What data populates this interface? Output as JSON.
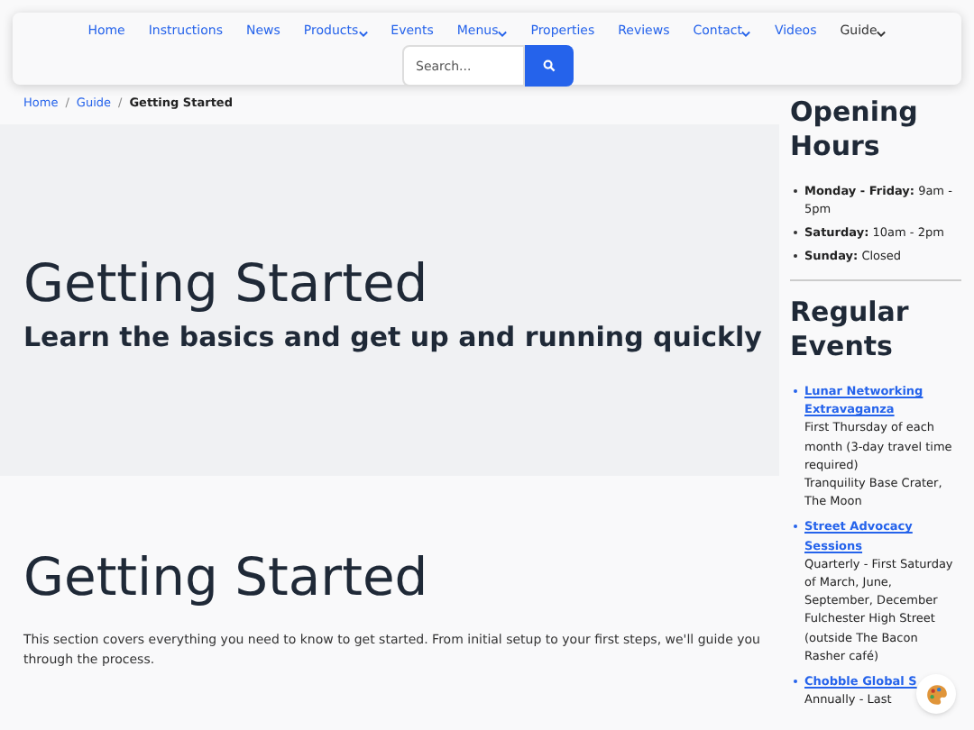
{
  "nav": {
    "items": [
      {
        "label": "Home",
        "dropdown": false,
        "selected": false
      },
      {
        "label": "Instructions",
        "dropdown": false,
        "selected": false
      },
      {
        "label": "News",
        "dropdown": false,
        "selected": false
      },
      {
        "label": "Products",
        "dropdown": true,
        "selected": false
      },
      {
        "label": "Events",
        "dropdown": false,
        "selected": false
      },
      {
        "label": "Menus",
        "dropdown": true,
        "selected": false
      },
      {
        "label": "Properties",
        "dropdown": false,
        "selected": false
      },
      {
        "label": "Reviews",
        "dropdown": false,
        "selected": false
      },
      {
        "label": "Contact",
        "dropdown": true,
        "selected": false
      },
      {
        "label": "Videos",
        "dropdown": false,
        "selected": false
      },
      {
        "label": "Guide",
        "dropdown": true,
        "selected": true
      }
    ],
    "search": {
      "placeholder": "Search..."
    }
  },
  "breadcrumb": [
    {
      "label": "Home",
      "separator": "/"
    },
    {
      "label": "Guide",
      "separator": "/"
    },
    {
      "label": "Getting Started"
    }
  ],
  "hero": {
    "title": "Getting Started",
    "subtitle": "Learn the basics and get up and running quickly"
  },
  "section": {
    "title": "Getting Started",
    "text": "This section covers everything you need to know to get started. From initial setup to your first steps, we'll guide you through the process."
  },
  "sidebar": {
    "hours_title": "Opening Hours",
    "hours": [
      {
        "day": "Monday - Friday:",
        "time": "9am - 5pm"
      },
      {
        "day": "Saturday:",
        "time": "10am - 2pm"
      },
      {
        "day": "Sunday:",
        "time": "Closed"
      }
    ],
    "events_title": "Regular Events",
    "events": [
      {
        "name": "Lunar Networking Extravaganza",
        "when": "First Thursday of each month (3-day travel time required)",
        "where": "Tranquility Base Crater, The Moon"
      },
      {
        "name": "Street Advocacy Sessions",
        "when": "Quarterly - First Saturday of March, June, September, December",
        "where": "Fulchester High Street (outside The Bacon Rasher café)"
      },
      {
        "name": "Chobble Global S",
        "when": "Annually - Last"
      }
    ]
  }
}
